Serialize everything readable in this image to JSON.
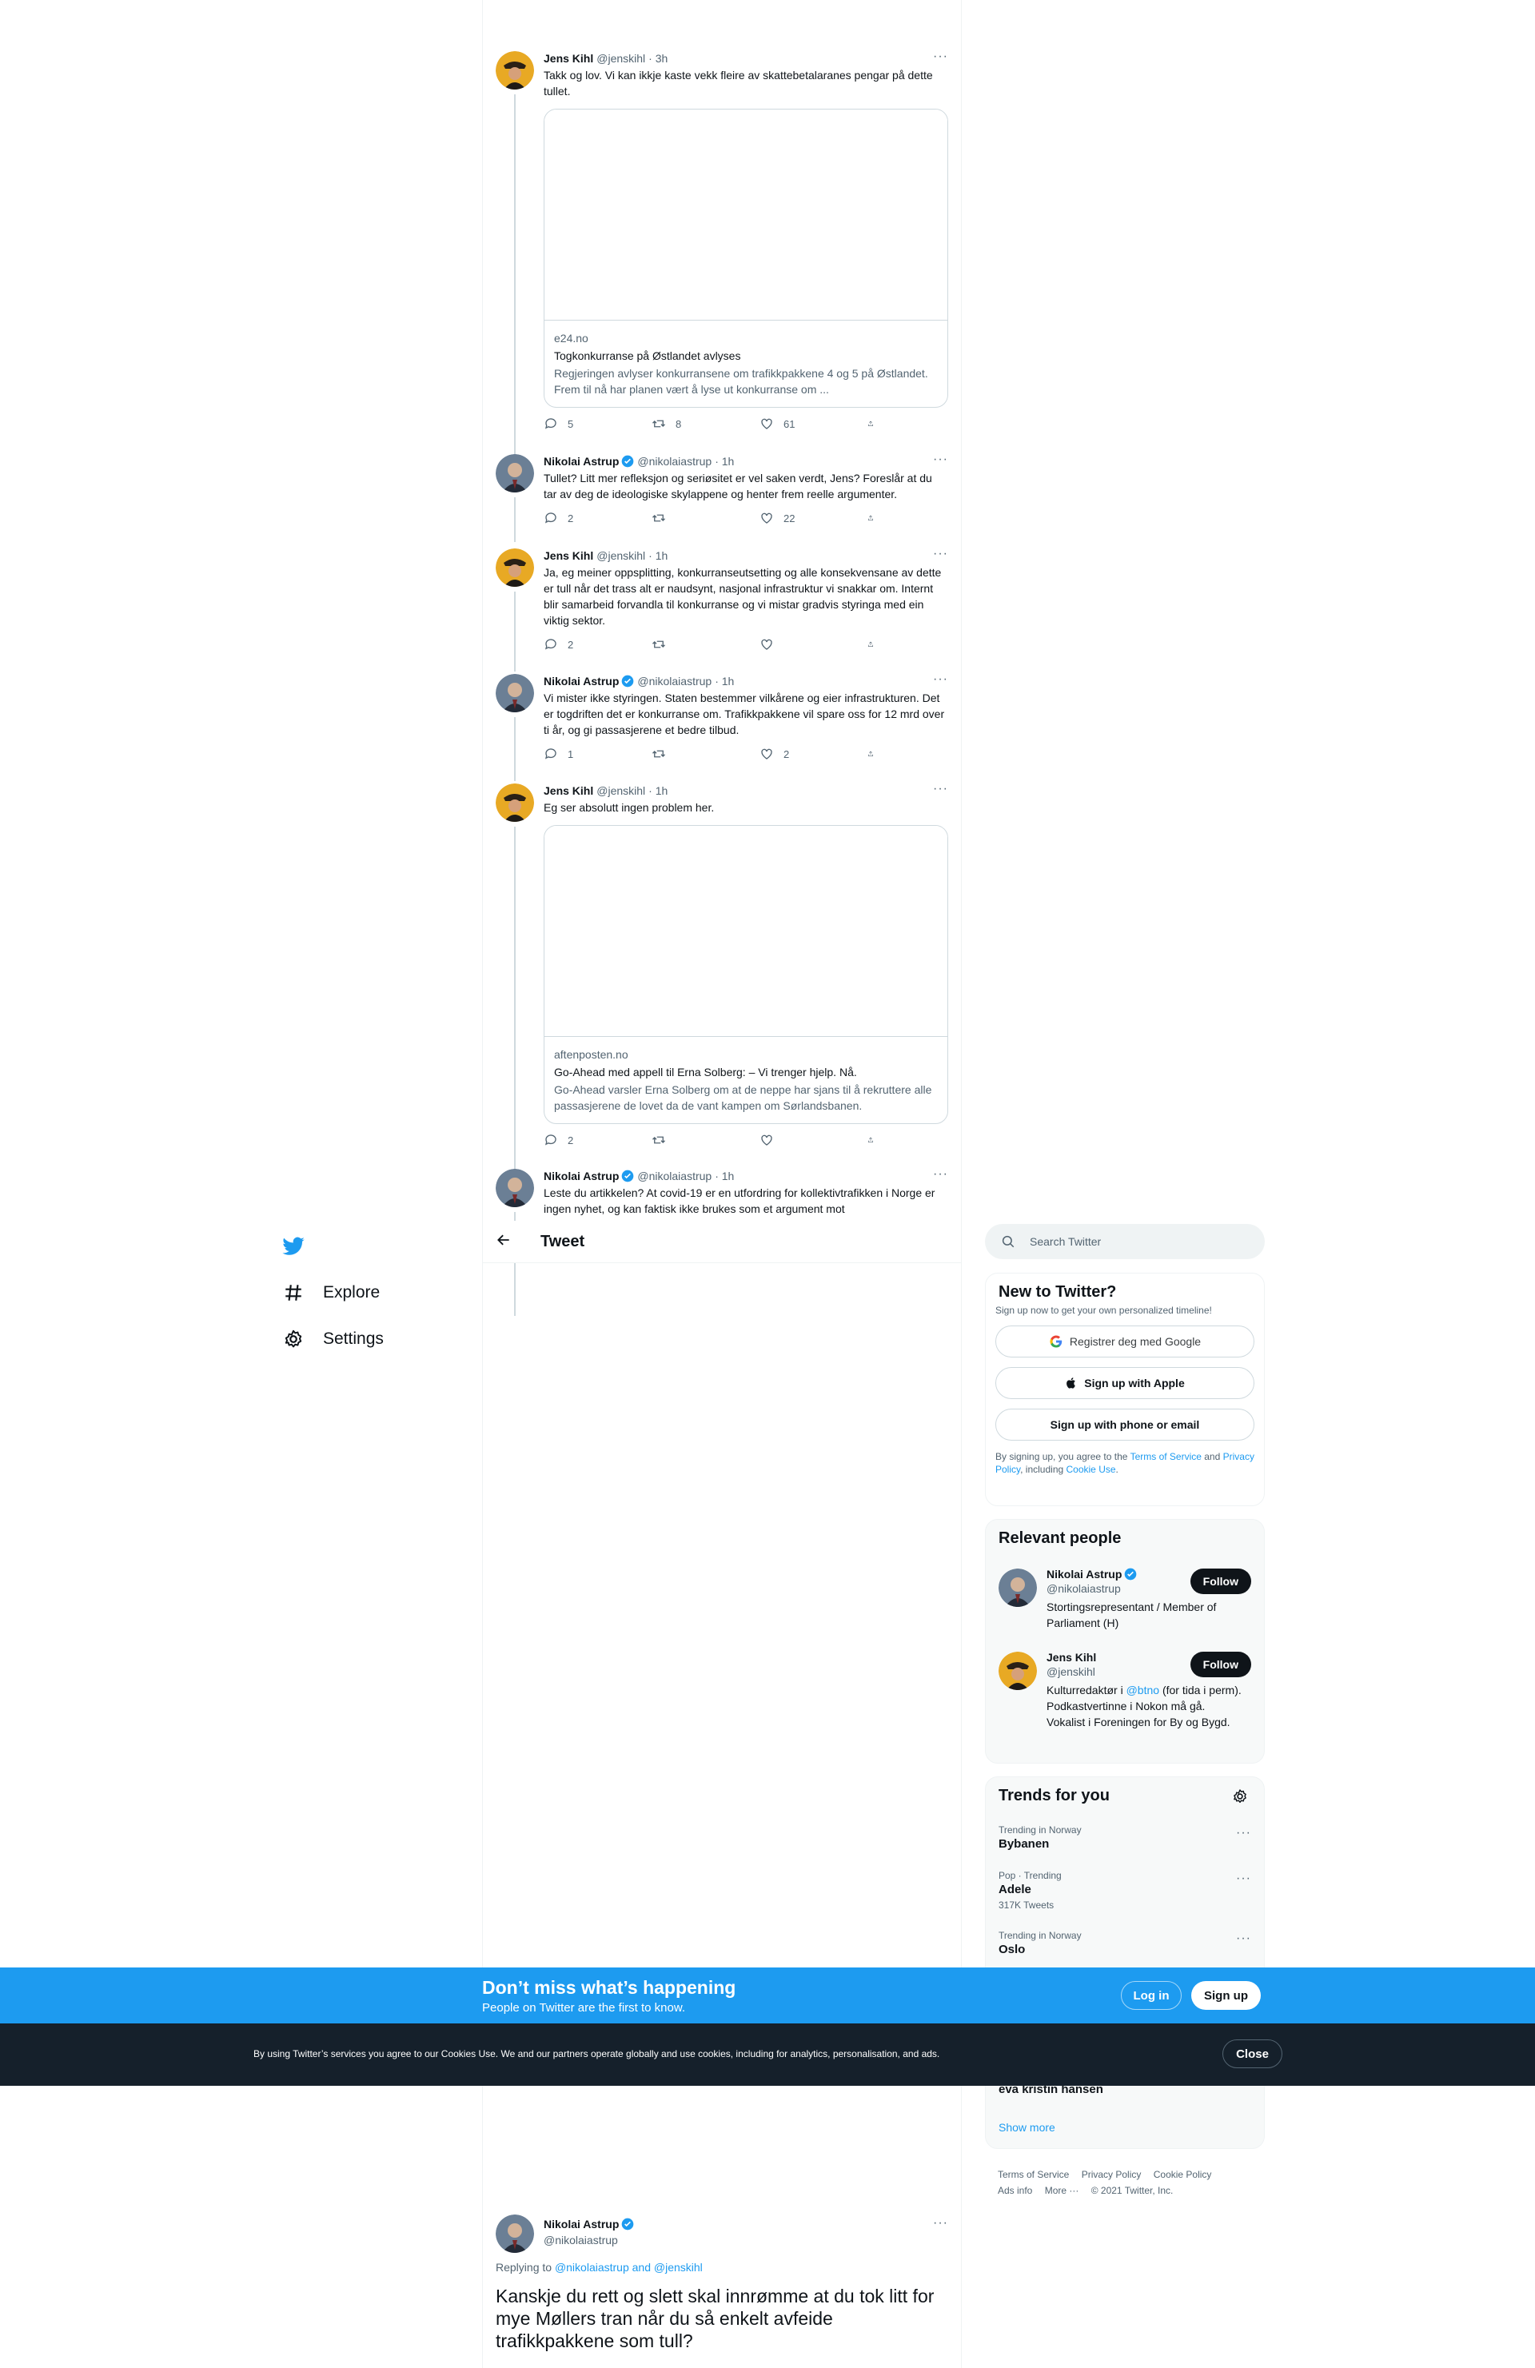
{
  "colors": {
    "accent": "#1d9bf0",
    "text": "#0f1419",
    "muted": "#536471",
    "banner": "#1d9bf0",
    "cookie_bg": "#15202b"
  },
  "nav": {
    "items": [
      {
        "label": "Explore",
        "icon": "hashtag-icon"
      },
      {
        "label": "Settings",
        "icon": "gear-icon"
      }
    ]
  },
  "header": {
    "title": "Tweet",
    "back_icon": "arrow-left-icon"
  },
  "thread": [
    {
      "name": "Jens Kihl",
      "handle": "@jenskihl",
      "time": "· 3h",
      "verified": false,
      "text": "Takk og lov. Vi kan ikkje kaste vekk fleire av skattebetalaranes pengar på dette tullet.",
      "card": {
        "domain": "e24.no",
        "title": "Togkonkurranse på Østlandet avlyses",
        "desc": "Regjeringen avlyser konkurransene om trafikkpakkene 4 og 5 på Østlandet. Frem til nå har planen vært å lyse ut konkurranse om ..."
      },
      "stats": {
        "replies": "5",
        "retweets": "8",
        "likes": "61"
      }
    },
    {
      "name": "Nikolai Astrup",
      "handle": "@nikolaiastrup",
      "time": "· 1h",
      "verified": true,
      "text": "Tullet? Litt mer refleksjon og seriøsitet er vel saken verdt, Jens? Foreslår at du tar av deg de ideologiske skylappene og henter frem reelle argumenter.",
      "stats": {
        "replies": "2",
        "retweets": "",
        "likes": "22"
      }
    },
    {
      "name": "Jens Kihl",
      "handle": "@jenskihl",
      "time": "· 1h",
      "verified": false,
      "text": "Ja, eg meiner oppsplitting, konkurranseutsetting og alle konsekvensane av dette er tull når det trass alt er naudsynt, nasjonal infrastruktur vi snakkar om. Internt blir samarbeid forvandla til konkurranse og vi mistar gradvis styringa med ein viktig sektor.",
      "stats": {
        "replies": "2",
        "retweets": "",
        "likes": ""
      }
    },
    {
      "name": "Nikolai Astrup",
      "handle": "@nikolaiastrup",
      "time": "· 1h",
      "verified": true,
      "text": "Vi mister ikke styringen. Staten bestemmer vilkårene og eier infrastrukturen. Det er togdriften det er konkurranse om. Trafikkpakkene vil spare oss for 12 mrd over ti år, og gi passasjerene et bedre tilbud.",
      "stats": {
        "replies": "1",
        "retweets": "",
        "likes": "2"
      }
    },
    {
      "name": "Jens Kihl",
      "handle": "@jenskihl",
      "time": "· 1h",
      "verified": false,
      "text": "Eg ser absolutt ingen problem her.",
      "card": {
        "domain": "aftenposten.no",
        "title": "Go-Ahead med appell til Erna Solberg: – Vi trenger hjelp. Nå.",
        "desc": "Go-Ahead varsler Erna Solberg om at de neppe har sjans til å rekruttere alle passasjerene de lovet da de vant kampen om Sørlandsbanen."
      },
      "stats": {
        "replies": "2",
        "retweets": "",
        "likes": ""
      }
    },
    {
      "name": "Nikolai Astrup",
      "handle": "@nikolaiastrup",
      "time": "· 1h",
      "verified": true,
      "text": "Leste du artikkelen? At covid-19 er en utfordring for kollektivtrafikken i Norge er ingen nyhet, og kan faktisk ikke brukes som et argument mot"
    }
  ],
  "search": {
    "placeholder": "Search Twitter"
  },
  "signup": {
    "title": "New to Twitter?",
    "subtitle": "Sign up now to get your own personalized timeline!",
    "google": "Registrer deg med Google",
    "apple": "Sign up with Apple",
    "phone": "Sign up with phone or email",
    "legal_1": "By signing up, you agree to the ",
    "terms": "Terms of Service",
    "legal_2": " and ",
    "privacy": "Privacy Policy",
    "legal_3": ", including ",
    "cookie": "Cookie Use",
    "legal_4": "."
  },
  "relevant": {
    "title": "Relevant people",
    "people": [
      {
        "name": "Nikolai Astrup",
        "handle": "@nikolaiastrup",
        "bio": "Stortingsrepresentant / Member of Parliament (H)",
        "follow": "Follow"
      },
      {
        "name": "Jens Kihl",
        "handle": "@jenskihl",
        "bio_1": "Kulturredaktør i ",
        "bio_link": "@btno",
        "bio_2": " (for tida i perm). Podkastvertinne i Nokon må gå. Vokalist i Foreningen for By og Bygd.",
        "follow": "Follow"
      }
    ]
  },
  "trends": {
    "title": "Trends for you",
    "items": [
      {
        "meta": "Trending in Norway",
        "name": "Bybanen",
        "count": ""
      },
      {
        "meta": "Pop · Trending",
        "name": "Adele",
        "count": "317K Tweets"
      },
      {
        "meta": "Trending in Norway",
        "name": "Oslo",
        "count": ""
      }
    ],
    "partial_name": "eva kristin hansen",
    "show_more": "Show more"
  },
  "footer": {
    "links": [
      "Terms of Service",
      "Privacy Policy",
      "Cookie Policy",
      "Ads info",
      "More ···",
      "© 2021 Twitter, Inc."
    ]
  },
  "banner": {
    "title": "Don’t miss what’s happening",
    "subtitle": "People on Twitter are the first to know.",
    "login": "Log in",
    "signup": "Sign up"
  },
  "cookie_bar": {
    "text": "By using Twitter’s services you agree to our Cookies Use. We and our partners operate globally and use cookies, including for analytics, personalisation, and ads.",
    "close": "Close"
  },
  "focus_tweet": {
    "name": "Nikolai Astrup",
    "handle": "@nikolaiastrup",
    "replying_prefix": "Replying to ",
    "replying_to": "@nikolaiastrup and @jenskihl",
    "text": "Kanskje du rett og slett skal innrømme at du tok litt for mye Møllers tran når du så enkelt avfeide trafikkpakkene som tull?"
  }
}
